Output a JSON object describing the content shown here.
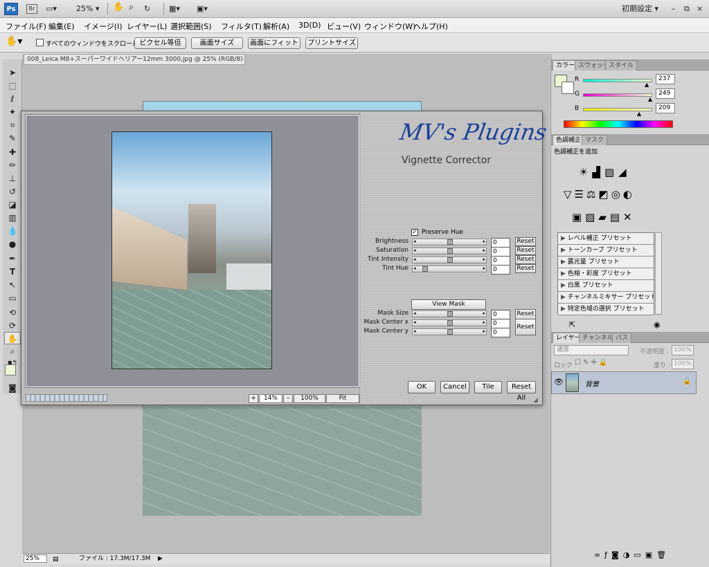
{
  "app": {
    "logo": "Ps",
    "bridge": "Br",
    "zoom_dropdown": "25%",
    "workspace": "初期設定 ▾",
    "win_controls": [
      "–",
      "⧉",
      "×"
    ]
  },
  "menu": [
    "ファイル(F)",
    "編集(E)",
    "イメージ(I)",
    "レイヤー(L)",
    "選択範囲(S)",
    "フィルタ(T)",
    "解析(A)",
    "3D(D)",
    "ビュー(V)",
    "ウィンドウ(W)",
    "ヘルプ(H)"
  ],
  "options": {
    "scroll_all_label": "すべてのウィンドウをスクロール",
    "buttons": [
      "ピクセル等倍",
      "画面サイズ",
      "画面にフィット",
      "プリントサイズ"
    ]
  },
  "document": {
    "tab_title": "008_Leica M8+スーパーワイドヘリアー12mm 3000.jpg @ 25% (RGB/8)",
    "tab_close": "×"
  },
  "status": {
    "zoom": "25%",
    "file_info": "ファイル : 17.3M/17.3M",
    "arrow": "▶"
  },
  "color_panel": {
    "tabs": [
      "カラー",
      "スウォッチ",
      "スタイル"
    ],
    "channels": [
      {
        "label": "R",
        "value": "237",
        "fraction": 0.93,
        "gradient": "linear-gradient(90deg,#00f9d1,#edf9d1)"
      },
      {
        "label": "G",
        "value": "249",
        "fraction": 0.98,
        "gradient": "linear-gradient(90deg,#ed00d1,#edf9d1)"
      },
      {
        "label": "B",
        "value": "209",
        "fraction": 0.82,
        "gradient": "linear-gradient(90deg,#edf900,#edf9d1)"
      }
    ],
    "fg_color": "#edf9d1"
  },
  "adjust_panel": {
    "tabs": [
      "色調補正",
      "マスク"
    ],
    "heading": "色調補正を追加",
    "presets": [
      "レベル補正 プリセット",
      "トーンカーブ プリセット",
      "露光量 プリセット",
      "色相・彩度 プリセット",
      "白黒 プリセット",
      "チャンネルミキサー プリセット",
      "特定色域の選択 プリセット"
    ]
  },
  "layers_panel": {
    "tabs": [
      "レイヤー",
      "チャンネル",
      "パス"
    ],
    "blend_mode": "通常",
    "opacity_label": "不透明度 :",
    "opacity_value": "100%",
    "lock_label": "ロック :",
    "fill_label": "塗り :",
    "fill_value": "100%",
    "layer_name": "背景"
  },
  "dialog": {
    "brand": "MV's Plugins",
    "title": "Vignette Corrector",
    "preserve_hue": "Preserve Hue",
    "preserve_hue_checked": true,
    "sliders": [
      {
        "label": "Brightness",
        "value": "0",
        "fraction": 0.5
      },
      {
        "label": "Saturation",
        "value": "0",
        "fraction": 0.5
      },
      {
        "label": "Tint Intensity",
        "value": "0",
        "fraction": 0.5
      },
      {
        "label": "Tint Hue",
        "value": "0",
        "fraction": 0.05
      }
    ],
    "reset_label": "Reset",
    "view_mask": "View Mask",
    "mask_sliders": [
      {
        "label": "Mask Size",
        "value": "0",
        "fraction": 0.5
      },
      {
        "label": "Mask Center x",
        "value": "0",
        "fraction": 0.5
      },
      {
        "label": "Mask Center y",
        "value": "0",
        "fraction": 0.5
      }
    ],
    "buttons": {
      "ok": "OK",
      "cancel": "Cancel",
      "tile": "Tile",
      "reset_all": "Reset All"
    },
    "zoom": {
      "plus": "+",
      "value": "14%",
      "minus": "–",
      "hundred": "100%",
      "fit": "Fit"
    }
  }
}
